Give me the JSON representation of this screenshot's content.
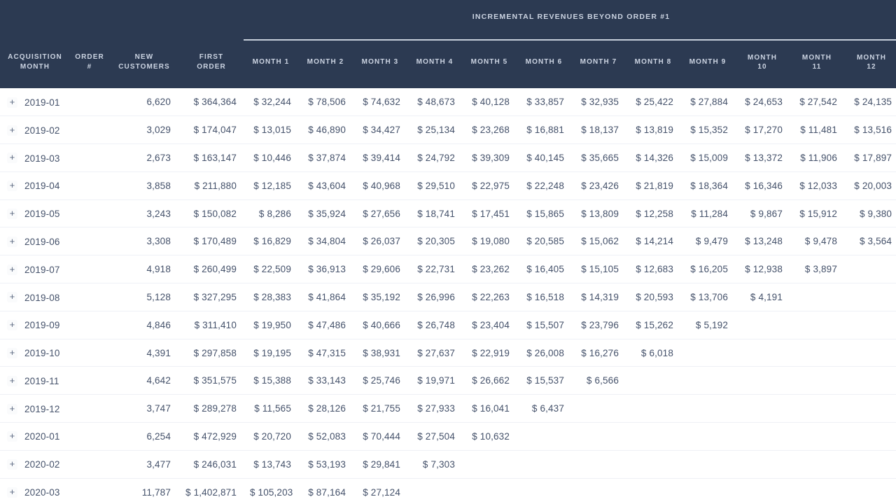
{
  "table": {
    "group_header": "INCREMENTAL REVENUES BEYOND ORDER #1",
    "columns": [
      {
        "key": "acquisition_month",
        "label_line1": "ACQUISITION",
        "label_line2": "MONTH"
      },
      {
        "key": "order_number",
        "label_line1": "ORDER",
        "label_line2": "#"
      },
      {
        "key": "new_customers",
        "label_line1": "NEW",
        "label_line2": "CUSTOMERS"
      },
      {
        "key": "first_order",
        "label_line1": "FIRST",
        "label_line2": "ORDER"
      },
      {
        "key": "month_1",
        "label_line1": "MONTH 1",
        "label_line2": ""
      },
      {
        "key": "month_2",
        "label_line1": "MONTH 2",
        "label_line2": ""
      },
      {
        "key": "month_3",
        "label_line1": "MONTH 3",
        "label_line2": ""
      },
      {
        "key": "month_4",
        "label_line1": "MONTH 4",
        "label_line2": ""
      },
      {
        "key": "month_5",
        "label_line1": "MONTH 5",
        "label_line2": ""
      },
      {
        "key": "month_6",
        "label_line1": "MONTH 6",
        "label_line2": ""
      },
      {
        "key": "month_7",
        "label_line1": "MONTH 7",
        "label_line2": ""
      },
      {
        "key": "month_8",
        "label_line1": "MONTH 8",
        "label_line2": ""
      },
      {
        "key": "month_9",
        "label_line1": "MONTH 9",
        "label_line2": ""
      },
      {
        "key": "month_10",
        "label_line1": "MONTH",
        "label_line2": "10"
      },
      {
        "key": "month_11",
        "label_line1": "MONTH",
        "label_line2": "11"
      },
      {
        "key": "month_12",
        "label_line1": "MONTH",
        "label_line2": "12"
      }
    ],
    "expander_glyph": "+",
    "rows": [
      {
        "acquisition_month": "2019-01",
        "order_number": "",
        "new_customers": "6,620",
        "first_order": "$ 364,364",
        "months": [
          "$ 32,244",
          "$ 78,506",
          "$ 74,632",
          "$ 48,673",
          "$ 40,128",
          "$ 33,857",
          "$ 32,935",
          "$ 25,422",
          "$ 27,884",
          "$ 24,653",
          "$ 27,542",
          "$ 24,135"
        ]
      },
      {
        "acquisition_month": "2019-02",
        "order_number": "",
        "new_customers": "3,029",
        "first_order": "$ 174,047",
        "months": [
          "$ 13,015",
          "$ 46,890",
          "$ 34,427",
          "$ 25,134",
          "$ 23,268",
          "$ 16,881",
          "$ 18,137",
          "$ 13,819",
          "$ 15,352",
          "$ 17,270",
          "$ 11,481",
          "$ 13,516"
        ]
      },
      {
        "acquisition_month": "2019-03",
        "order_number": "",
        "new_customers": "2,673",
        "first_order": "$ 163,147",
        "months": [
          "$ 10,446",
          "$ 37,874",
          "$ 39,414",
          "$ 24,792",
          "$ 39,309",
          "$ 40,145",
          "$ 35,665",
          "$ 14,326",
          "$ 15,009",
          "$ 13,372",
          "$ 11,906",
          "$ 17,897"
        ]
      },
      {
        "acquisition_month": "2019-04",
        "order_number": "",
        "new_customers": "3,858",
        "first_order": "$ 211,880",
        "months": [
          "$ 12,185",
          "$ 43,604",
          "$ 40,968",
          "$ 29,510",
          "$ 22,975",
          "$ 22,248",
          "$ 23,426",
          "$ 21,819",
          "$ 18,364",
          "$ 16,346",
          "$ 12,033",
          "$ 20,003"
        ]
      },
      {
        "acquisition_month": "2019-05",
        "order_number": "",
        "new_customers": "3,243",
        "first_order": "$ 150,082",
        "months": [
          "$ 8,286",
          "$ 35,924",
          "$ 27,656",
          "$ 18,741",
          "$ 17,451",
          "$ 15,865",
          "$ 13,809",
          "$ 12,258",
          "$ 11,284",
          "$ 9,867",
          "$ 15,912",
          "$ 9,380"
        ]
      },
      {
        "acquisition_month": "2019-06",
        "order_number": "",
        "new_customers": "3,308",
        "first_order": "$ 170,489",
        "months": [
          "$ 16,829",
          "$ 34,804",
          "$ 26,037",
          "$ 20,305",
          "$ 19,080",
          "$ 20,585",
          "$ 15,062",
          "$ 14,214",
          "$ 9,479",
          "$ 13,248",
          "$ 9,478",
          "$ 3,564"
        ]
      },
      {
        "acquisition_month": "2019-07",
        "order_number": "",
        "new_customers": "4,918",
        "first_order": "$ 260,499",
        "months": [
          "$ 22,509",
          "$ 36,913",
          "$ 29,606",
          "$ 22,731",
          "$ 23,262",
          "$ 16,405",
          "$ 15,105",
          "$ 12,683",
          "$ 16,205",
          "$ 12,938",
          "$ 3,897",
          ""
        ]
      },
      {
        "acquisition_month": "2019-08",
        "order_number": "",
        "new_customers": "5,128",
        "first_order": "$ 327,295",
        "months": [
          "$ 28,383",
          "$ 41,864",
          "$ 35,192",
          "$ 26,996",
          "$ 22,263",
          "$ 16,518",
          "$ 14,319",
          "$ 20,593",
          "$ 13,706",
          "$ 4,191",
          "",
          ""
        ]
      },
      {
        "acquisition_month": "2019-09",
        "order_number": "",
        "new_customers": "4,846",
        "first_order": "$ 311,410",
        "months": [
          "$ 19,950",
          "$ 47,486",
          "$ 40,666",
          "$ 26,748",
          "$ 23,404",
          "$ 15,507",
          "$ 23,796",
          "$ 15,262",
          "$ 5,192",
          "",
          "",
          ""
        ]
      },
      {
        "acquisition_month": "2019-10",
        "order_number": "",
        "new_customers": "4,391",
        "first_order": "$ 297,858",
        "months": [
          "$ 19,195",
          "$ 47,315",
          "$ 38,931",
          "$ 27,637",
          "$ 22,919",
          "$ 26,008",
          "$ 16,276",
          "$ 6,018",
          "",
          "",
          "",
          ""
        ]
      },
      {
        "acquisition_month": "2019-11",
        "order_number": "",
        "new_customers": "4,642",
        "first_order": "$ 351,575",
        "months": [
          "$ 15,388",
          "$ 33,143",
          "$ 25,746",
          "$ 19,971",
          "$ 26,662",
          "$ 15,537",
          "$ 6,566",
          "",
          "",
          "",
          "",
          ""
        ]
      },
      {
        "acquisition_month": "2019-12",
        "order_number": "",
        "new_customers": "3,747",
        "first_order": "$ 289,278",
        "months": [
          "$ 11,565",
          "$ 28,126",
          "$ 21,755",
          "$ 27,933",
          "$ 16,041",
          "$ 6,437",
          "",
          "",
          "",
          "",
          "",
          ""
        ]
      },
      {
        "acquisition_month": "2020-01",
        "order_number": "",
        "new_customers": "6,254",
        "first_order": "$ 472,929",
        "months": [
          "$ 20,720",
          "$ 52,083",
          "$ 70,444",
          "$ 27,504",
          "$ 10,632",
          "",
          "",
          "",
          "",
          "",
          "",
          ""
        ]
      },
      {
        "acquisition_month": "2020-02",
        "order_number": "",
        "new_customers": "3,477",
        "first_order": "$ 246,031",
        "months": [
          "$ 13,743",
          "$ 53,193",
          "$ 29,841",
          "$ 7,303",
          "",
          "",
          "",
          "",
          "",
          "",
          "",
          ""
        ]
      },
      {
        "acquisition_month": "2020-03",
        "order_number": "",
        "new_customers": "11,787",
        "first_order": "$ 1,402,871",
        "months": [
          "$ 105,203",
          "$ 87,164",
          "$ 27,124",
          "",
          "",
          "",
          "",
          "",
          "",
          "",
          "",
          ""
        ]
      }
    ]
  },
  "colors": {
    "header_background": "#2c3a52",
    "header_text": "#ccd4e2",
    "body_text": "#44516a",
    "row_divider": "#eef1f6",
    "page_background": "#ffffff"
  }
}
